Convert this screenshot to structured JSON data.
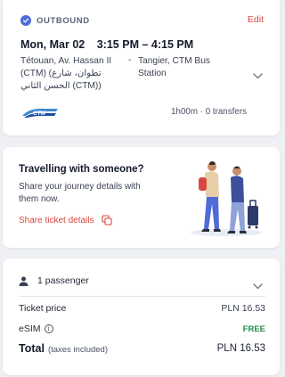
{
  "trip": {
    "direction_label": "OUTBOUND",
    "edit_label": "Edit",
    "date": "Mon, Mar 02",
    "time_range": "3:15 PM – 4:15 PM",
    "origin": "Tétouan, Av. Hassan II (CTM) (تطوان، شارع الحسن الثاني (CTM))",
    "destination_dash": "-",
    "destination": "Tangier, CTM Bus Station",
    "carrier_logo_text": "CTM",
    "duration": "1h00m · 0 transfers"
  },
  "share": {
    "title": "Travelling with someone?",
    "text": "Share your journey details with them now.",
    "link_label": "Share ticket details"
  },
  "price": {
    "passengers_label": "1 passenger",
    "ticket_label": "Ticket price",
    "ticket_value": "PLN 16.53",
    "esim_label": "eSIM",
    "esim_value": "FREE",
    "total_label": "Total",
    "total_sub": "(taxes included)",
    "total_value": "PLN 16.53"
  },
  "colors": {
    "accent_red": "#d9473f",
    "accent_blue": "#4f6bd8",
    "free_green": "#1e8a4a"
  }
}
